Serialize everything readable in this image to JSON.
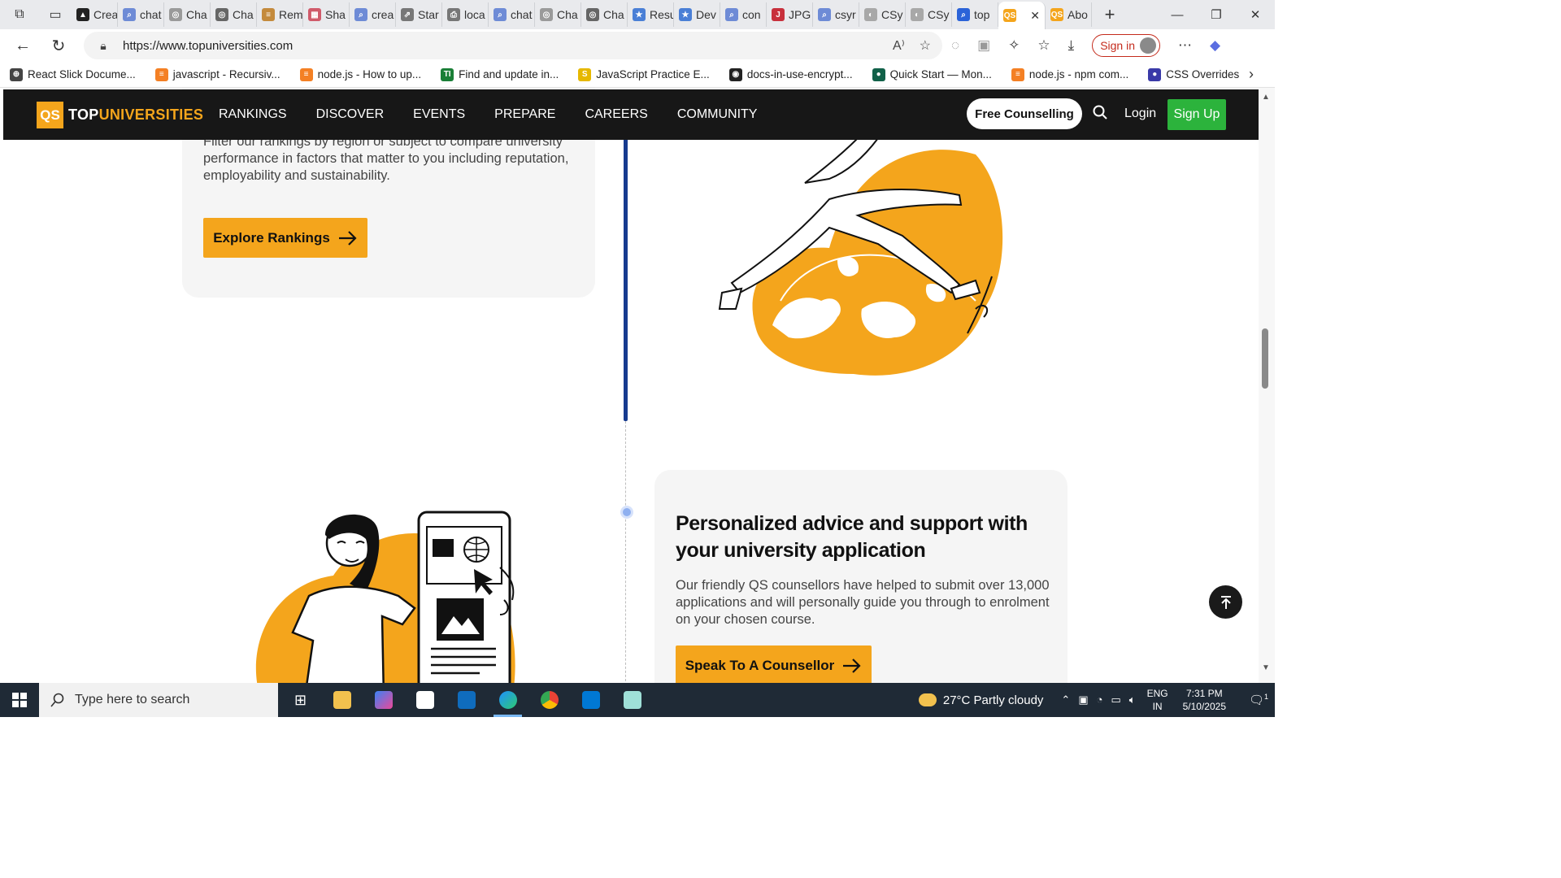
{
  "browser": {
    "tabs": [
      {
        "label": "Crea",
        "fav_color": "#222222",
        "fav_glyph": "▲"
      },
      {
        "label": "chat",
        "fav_color": "#6e8bd6",
        "fav_glyph": "⌕"
      },
      {
        "label": "Cha",
        "fav_color": "#9a9a9a",
        "fav_glyph": "◎"
      },
      {
        "label": "Cha",
        "fav_color": "#666666",
        "fav_glyph": "◎"
      },
      {
        "label": "Rem",
        "fav_color": "#c48a3c",
        "fav_glyph": "≡"
      },
      {
        "label": "Sha",
        "fav_color": "#d05a6a",
        "fav_glyph": "▦"
      },
      {
        "label": "crea",
        "fav_color": "#6e8bd6",
        "fav_glyph": "⌕"
      },
      {
        "label": "Star",
        "fav_color": "#777777",
        "fav_glyph": "⇗"
      },
      {
        "label": "loca",
        "fav_color": "#777777",
        "fav_glyph": "⎙"
      },
      {
        "label": "chat",
        "fav_color": "#6e8bd6",
        "fav_glyph": "⌕"
      },
      {
        "label": "Cha",
        "fav_color": "#9a9a9a",
        "fav_glyph": "◎"
      },
      {
        "label": "Cha",
        "fav_color": "#666666",
        "fav_glyph": "◎"
      },
      {
        "label": "Resu",
        "fav_color": "#4a7fd6",
        "fav_glyph": "★"
      },
      {
        "label": "Dev",
        "fav_color": "#4a7fd6",
        "fav_glyph": "★"
      },
      {
        "label": "con",
        "fav_color": "#6e8bd6",
        "fav_glyph": "⌕"
      },
      {
        "label": "JPG",
        "fav_color": "#c8303c",
        "fav_glyph": "J"
      },
      {
        "label": "csyr",
        "fav_color": "#6e8bd6",
        "fav_glyph": "⌕"
      },
      {
        "label": "CSy",
        "fav_color": "#a8a8a8",
        "fav_glyph": "◐"
      },
      {
        "label": "CSy",
        "fav_color": "#a8a8a8",
        "fav_glyph": "◐"
      },
      {
        "label": "top",
        "fav_color": "#2b63d8",
        "fav_glyph": "⌕"
      },
      {
        "label": "",
        "fav_color": "#f4a51c",
        "fav_glyph": "QS",
        "active": true
      },
      {
        "label": "Abo",
        "fav_color": "#f4a51c",
        "fav_glyph": "QS"
      }
    ],
    "new_tab": "+",
    "url": "https://www.topuniversities.com",
    "sign_in": "Sign in",
    "bookmarks": [
      {
        "label": "React Slick Docume...",
        "fav_color": "#444444",
        "fav_glyph": "⊕"
      },
      {
        "label": "javascript - Recursiv...",
        "fav_color": "#f48024",
        "fav_glyph": "≡"
      },
      {
        "label": "node.js - How to up...",
        "fav_color": "#f48024",
        "fav_glyph": "≡"
      },
      {
        "label": "Find and update in...",
        "fav_color": "#1a7f37",
        "fav_glyph": "TI"
      },
      {
        "label": "JavaScript Practice E...",
        "fav_color": "#e6b800",
        "fav_glyph": "S"
      },
      {
        "label": "docs-in-use-encrypt...",
        "fav_color": "#222222",
        "fav_glyph": "◉"
      },
      {
        "label": "Quick Start — Mon...",
        "fav_color": "#116149",
        "fav_glyph": "●"
      },
      {
        "label": "node.js - npm com...",
        "fav_color": "#f48024",
        "fav_glyph": "≡"
      },
      {
        "label": "CSS Overrides",
        "fav_color": "#3a3aa8",
        "fav_glyph": "●"
      }
    ]
  },
  "site": {
    "logo_prefix": "TOP",
    "logo_suffix": "UNIVERSITIES",
    "logo_badge": "QS",
    "nav": [
      "RANKINGS",
      "DISCOVER",
      "EVENTS",
      "PREPARE",
      "CAREERS",
      "COMMUNITY"
    ],
    "free_counselling": "Free Counselling",
    "login": "Login",
    "sign_up": "Sign Up",
    "rankings_card": {
      "text": "Filter our rankings by region or subject to compare university performance in factors that matter to you including reputation, employability and sustainability.",
      "button": "Explore Rankings"
    },
    "counsellor_card": {
      "title": "Personalized advice and support with your university application",
      "text": "Our friendly QS counsellors have helped to submit over 13,000 applications and will personally guide you through to enrolment on your chosen course.",
      "button": "Speak To A Counsellor"
    },
    "accent_color": "#f4a51c",
    "nav_bg": "#171717",
    "signup_color": "#2cb33c",
    "timeline_color": "#173b8f"
  },
  "taskbar": {
    "search_placeholder": "Type here to search",
    "weather": "27°C  Partly cloudy",
    "lang_line1": "ENG",
    "lang_line2": "IN",
    "time": "7:31 PM",
    "date": "5/10/2025",
    "notifications": "1"
  }
}
